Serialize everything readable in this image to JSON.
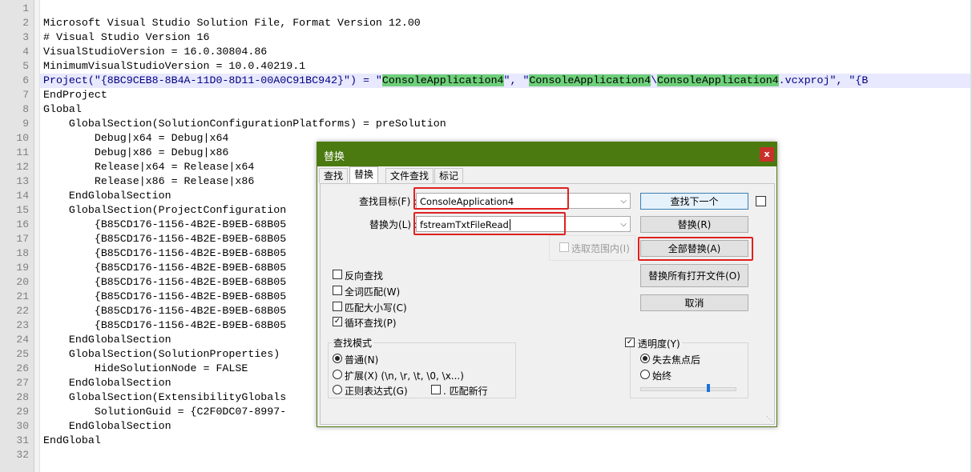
{
  "editor": {
    "lines": [
      {
        "n": "1",
        "text": ""
      },
      {
        "n": "2",
        "text": "Microsoft Visual Studio Solution File, Format Version 12.00"
      },
      {
        "n": "3",
        "text": "# Visual Studio Version 16"
      },
      {
        "n": "4",
        "text": "VisualStudioVersion = 16.0.30804.86"
      },
      {
        "n": "5",
        "text": "MinimumVisualStudioVersion = 10.0.40219.1"
      },
      {
        "n": "6",
        "text": ""
      },
      {
        "n": "7",
        "text": "EndProject"
      },
      {
        "n": "8",
        "text": "Global"
      },
      {
        "n": "9",
        "text": "    GlobalSection(SolutionConfigurationPlatforms) = preSolution"
      },
      {
        "n": "10",
        "text": "        Debug|x64 = Debug|x64"
      },
      {
        "n": "11",
        "text": "        Debug|x86 = Debug|x86"
      },
      {
        "n": "12",
        "text": "        Release|x64 = Release|x64"
      },
      {
        "n": "13",
        "text": "        Release|x86 = Release|x86"
      },
      {
        "n": "14",
        "text": "    EndGlobalSection"
      },
      {
        "n": "15",
        "text": "    GlobalSection(ProjectConfiguration"
      },
      {
        "n": "16",
        "text": "        {B85CD176-1156-4B2E-B9EB-68B05"
      },
      {
        "n": "17",
        "text": "        {B85CD176-1156-4B2E-B9EB-68B05"
      },
      {
        "n": "18",
        "text": "        {B85CD176-1156-4B2E-B9EB-68B05"
      },
      {
        "n": "19",
        "text": "        {B85CD176-1156-4B2E-B9EB-68B05"
      },
      {
        "n": "20",
        "text": "        {B85CD176-1156-4B2E-B9EB-68B05"
      },
      {
        "n": "21",
        "text": "        {B85CD176-1156-4B2E-B9EB-68B05"
      },
      {
        "n": "22",
        "text": "        {B85CD176-1156-4B2E-B9EB-68B05"
      },
      {
        "n": "23",
        "text": "        {B85CD176-1156-4B2E-B9EB-68B05"
      },
      {
        "n": "24",
        "text": "    EndGlobalSection"
      },
      {
        "n": "25",
        "text": "    GlobalSection(SolutionProperties)"
      },
      {
        "n": "26",
        "text": "        HideSolutionNode = FALSE"
      },
      {
        "n": "27",
        "text": "    EndGlobalSection"
      },
      {
        "n": "28",
        "text": "    GlobalSection(ExtensibilityGlobals"
      },
      {
        "n": "29",
        "text": "        SolutionGuid = {C2F0DC07-8997-"
      },
      {
        "n": "30",
        "text": "    EndGlobalSection"
      },
      {
        "n": "31",
        "text": "EndGlobal"
      },
      {
        "n": "32",
        "text": ""
      }
    ],
    "line6": {
      "p1": "Project(\"{8BC9CEB8-8B4A-11D0-8D11-00A0C91BC942}\") = \"",
      "m1": "ConsoleApplication4",
      "p2": "\", \"",
      "m2": "ConsoleApplication4",
      "p3": "\\",
      "m3": "ConsoleApplication4",
      "p4": ".vcxproj\", \"{B"
    }
  },
  "dialog": {
    "title": "替换",
    "close": "x",
    "tabs": [
      "查找",
      "替换",
      "文件查找",
      "标记"
    ],
    "find_label": "查找目标(F) :",
    "find_value": "ConsoleApplication4",
    "replace_label": "替换为(L) :",
    "replace_value": "fstreamTxtFileRead",
    "in_selection": "选取范围内(I)",
    "buttons": {
      "find_next": "查找下一个",
      "replace": "替换(R)",
      "replace_all": "全部替换(A)",
      "replace_all_open": "替换所有打开文件(O)",
      "cancel": "取消"
    },
    "options": [
      {
        "label": "反向查找",
        "checked": false
      },
      {
        "label": "全词匹配(W)",
        "checked": false
      },
      {
        "label": "匹配大小写(C)",
        "checked": false
      },
      {
        "label": "循环查找(P)",
        "checked": true
      }
    ],
    "search_mode": {
      "title": "查找模式",
      "normal": "普通(N)",
      "extended": "扩展(X) (\\n, \\r, \\t, \\0, \\x...)",
      "regex": "正则表达式(G)",
      "dot_newline": ". 匹配新行",
      "selected": "normal"
    },
    "transparency": {
      "label": "透明度(Y)",
      "checked": true,
      "on_lose_focus": "失去焦点后",
      "always": "始终",
      "selected": "on_lose_focus",
      "slider_fraction": 0.72
    },
    "colors": {
      "titlebar": "#4b7a10",
      "highlight": "#e02020",
      "match": "#6ed07a"
    }
  }
}
